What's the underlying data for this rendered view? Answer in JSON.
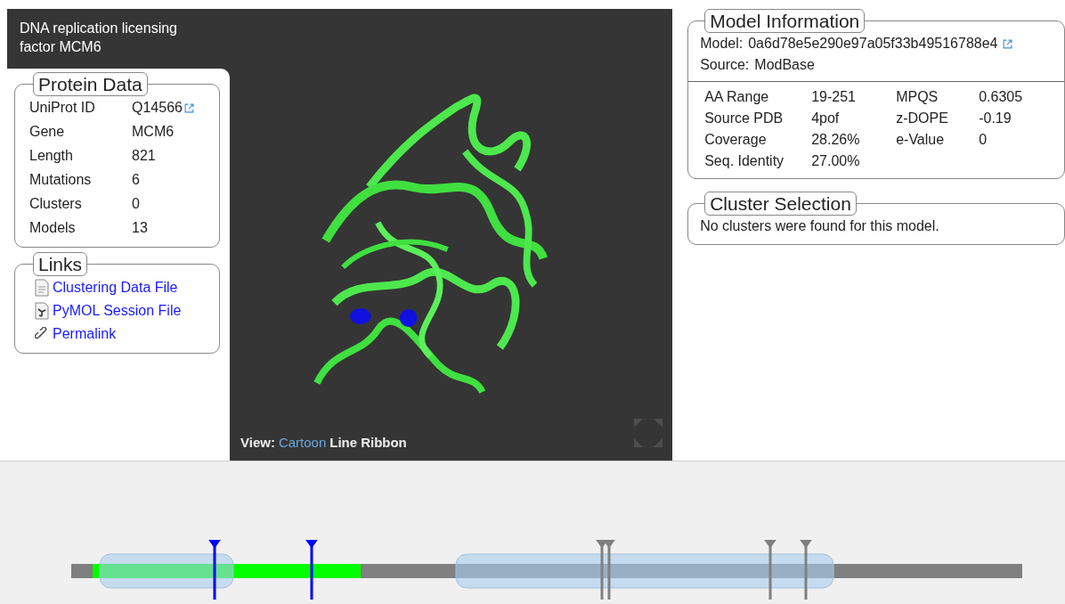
{
  "title": "DNA replication licensing factor MCM6",
  "protein_data": {
    "legend": "Protein Data",
    "rows": [
      {
        "label": "UniProt ID",
        "value": "Q14566",
        "kind": "link"
      },
      {
        "label": "Gene",
        "value": "MCM6",
        "kind": "text"
      },
      {
        "label": "Length",
        "value": "821",
        "kind": "text"
      },
      {
        "label": "Mutations",
        "value": "6",
        "kind": "text"
      },
      {
        "label": "Clusters",
        "value": "0",
        "kind": "text"
      },
      {
        "label": "Models",
        "value": "13",
        "kind": "text"
      }
    ]
  },
  "links": {
    "legend": "Links",
    "items": [
      {
        "label": "Clustering Data File",
        "kind": "file"
      },
      {
        "label": "PyMOL Session File",
        "kind": "pymol"
      },
      {
        "label": "Permalink",
        "kind": "chain"
      }
    ]
  },
  "viewer": {
    "view_label": "View:",
    "modes": [
      {
        "label": "Cartoon",
        "selected": true
      },
      {
        "label": "Line",
        "selected": false
      },
      {
        "label": "Ribbon",
        "selected": false
      }
    ]
  },
  "model_info": {
    "legend": "Model Information",
    "model_label": "Model:",
    "model_id": "0a6d78e5e290e97a05f33b49516788e4",
    "source_label": "Source:",
    "source": "ModBase",
    "stats": [
      {
        "label": "AA Range",
        "value": "19-251"
      },
      {
        "label": "MPQS",
        "value": "0.6305"
      },
      {
        "label": "Source PDB",
        "value": "4pof"
      },
      {
        "label": "z-DOPE",
        "value": "-0.19"
      },
      {
        "label": "Coverage",
        "value": "28.26%"
      },
      {
        "label": "e-Value",
        "value": "0"
      },
      {
        "label": "Seq. Identity",
        "value": "27.00%"
      }
    ]
  },
  "cluster_selection": {
    "legend": "Cluster Selection",
    "message": "No clusters were found for this model."
  }
}
